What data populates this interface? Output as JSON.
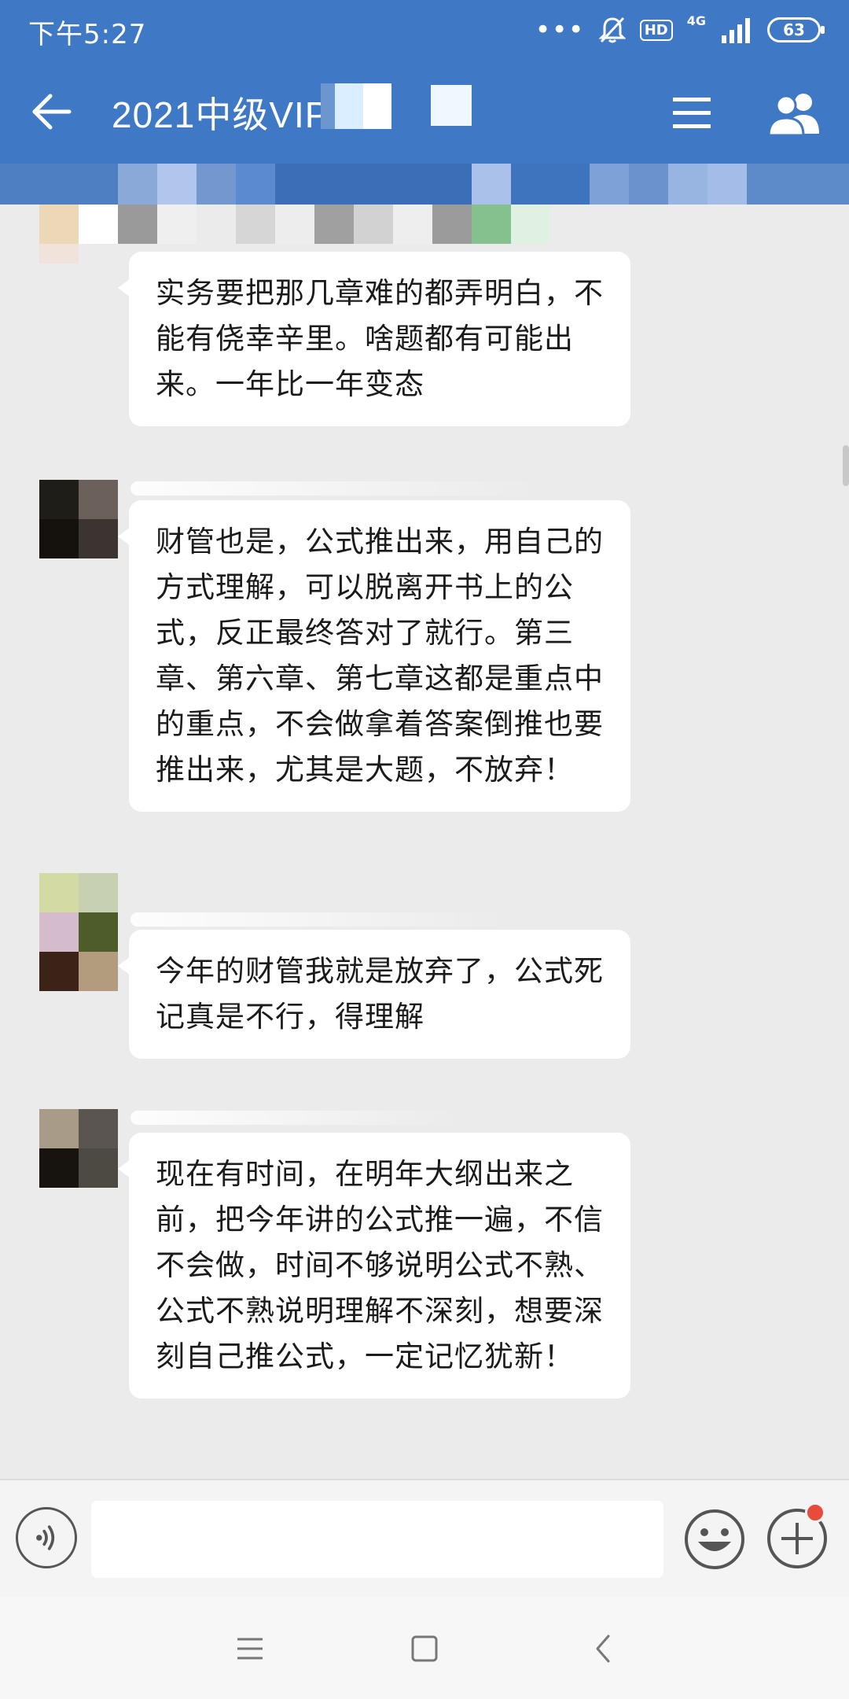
{
  "status_bar": {
    "time": "下午5:27",
    "dots": "•••",
    "hd_label": "HD",
    "network": "4G",
    "battery": "63"
  },
  "header": {
    "title": "2021中级VIP"
  },
  "messages": [
    {
      "text": "实务要把那几章难的都弄明白，不能有侥幸辛里。啥题都有可能出来。一年比一年变态"
    },
    {
      "text": "财管也是，公式推出来，用自己的方式理解，可以脱离开书上的公式，反正最终答对了就行。第三章、第六章、第七章这都是重点中的重点，不会做拿着答案倒推也要推出来，尤其是大题，不放弃！"
    },
    {
      "text": "今年的财管我就是放弃了，公式死记真是不行，得理解"
    },
    {
      "text": "现在有时间，在明年大纲出来之前，把今年讲的公式推一遍，不信不会做，时间不够说明公式不熟、公式不熟说明理解不深刻，想要深刻自己推公式，一定记忆犹新！"
    }
  ],
  "input_bar": {
    "value": ""
  },
  "colors": {
    "header_bg": "#3f78c4",
    "chat_bg": "#ebebeb",
    "badge": "#e84a3c"
  },
  "icons": [
    "back-arrow-icon",
    "menu-icon",
    "members-icon",
    "voice-icon",
    "emoji-icon",
    "plus-icon",
    "nav-recents-icon",
    "nav-home-icon",
    "nav-back-icon",
    "bell-muted-icon",
    "signal-icon"
  ]
}
